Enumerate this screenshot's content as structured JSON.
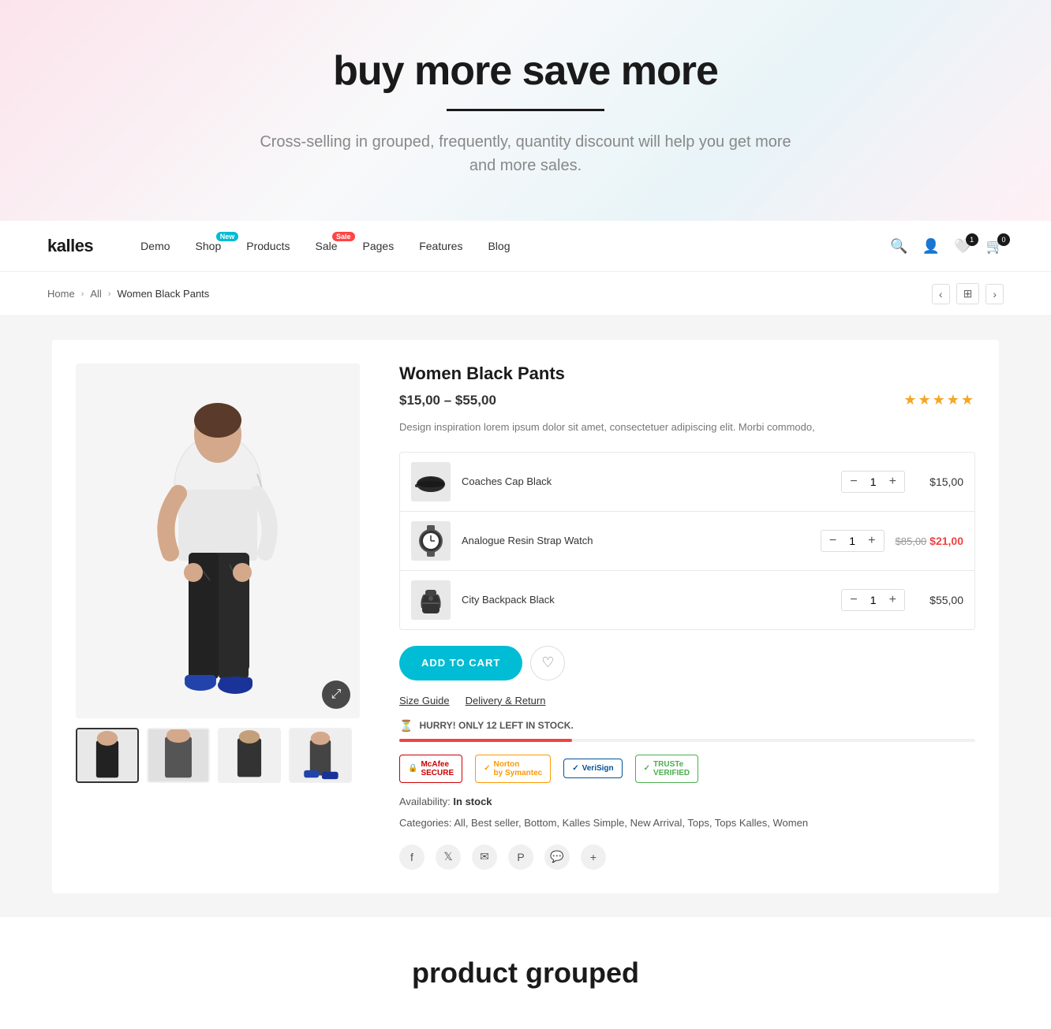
{
  "hero": {
    "title": "buy more save more",
    "subtitle": "Cross-selling in grouped, frequently,  quantity discount\nwill help you get more and more sales."
  },
  "navbar": {
    "logo": "kalles",
    "links": [
      {
        "label": "Demo",
        "badge": null
      },
      {
        "label": "Shop",
        "badge": "New",
        "badge_type": "new"
      },
      {
        "label": "Products",
        "badge": null
      },
      {
        "label": "Sale",
        "badge": "Sale",
        "badge_type": "sale"
      },
      {
        "label": "Pages",
        "badge": null
      },
      {
        "label": "Features",
        "badge": null
      },
      {
        "label": "Blog",
        "badge": null
      }
    ],
    "wishlist_count": "1",
    "cart_count": "0"
  },
  "breadcrumb": {
    "home": "Home",
    "all": "All",
    "current": "Women Black Pants"
  },
  "product": {
    "title": "Women Black Pants",
    "price": "$15,00 – $55,00",
    "description": "Design inspiration lorem ipsum dolor sit amet, consectetuer adipiscing elit. Morbi commodo,",
    "availability": "In stock",
    "categories": "All, Best seller, Bottom, Kalles Simple, New Arrival, Tops, Tops Kalles, Women",
    "items": [
      {
        "name": "Coaches Cap Black",
        "qty": 1,
        "price": "$15,00",
        "price_sale": null,
        "price_old": null,
        "icon": "cap"
      },
      {
        "name": "Analogue Resin Strap Watch",
        "qty": 1,
        "price": "$21,00",
        "price_sale": "$21,00",
        "price_old": "$85,00",
        "icon": "watch"
      },
      {
        "name": "City Backpack Black",
        "qty": 1,
        "price": "$55,00",
        "price_sale": null,
        "price_old": null,
        "icon": "bag"
      }
    ],
    "add_to_cart": "ADD TO CART",
    "size_guide": "Size Guide",
    "delivery": "Delivery & Return",
    "stock_warning": "HURRY! ONLY 12 LEFT IN STOCK.",
    "trust_badges": [
      {
        "name": "McAfee SECURE",
        "icon": "🔒"
      },
      {
        "name": "Norton by Symantec",
        "icon": "✓"
      },
      {
        "name": "VeriSign",
        "icon": "✓"
      },
      {
        "name": "TRUSTe VERIFIED",
        "icon": "✓"
      }
    ]
  },
  "bottom": {
    "title": "product grouped"
  }
}
